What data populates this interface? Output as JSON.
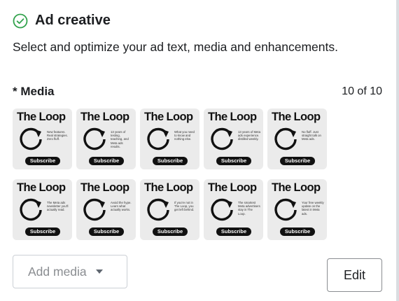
{
  "header": {
    "title": "Ad creative",
    "subtitle": "Select and optimize your ad text, media and enhancements."
  },
  "media": {
    "label": "* Media",
    "count": "10 of 10",
    "thumbnails": [
      {
        "title": "The Loop",
        "text": "New features. Real strategies. Zero fluff.",
        "button": "Subscribe"
      },
      {
        "title": "The Loop",
        "text": "13 years of testing, teaching, and Meta ads results.",
        "button": "Subscribe"
      },
      {
        "title": "The Loop",
        "text": "What you need to know and nothing else.",
        "button": "Subscribe"
      },
      {
        "title": "The Loop",
        "text": "13 years of Meta ads experience. distilled weekly.",
        "button": "Subscribe"
      },
      {
        "title": "The Loop",
        "text": "No fluff. Just straight talk on Meta ads.",
        "button": "Subscribe"
      },
      {
        "title": "The Loop",
        "text": "The Meta ads newsletter you'll actually read.",
        "button": "Subscribe"
      },
      {
        "title": "The Loop",
        "text": "Avoid the hype. Learn what actually works.",
        "button": "Subscribe"
      },
      {
        "title": "The Loop",
        "text": "If you're not in The Loop, you get left behind.",
        "button": "Subscribe"
      },
      {
        "title": "The Loop",
        "text": "The smartest Meta advertisers stay in The Loop.",
        "button": "Subscribe"
      },
      {
        "title": "The Loop",
        "text": "Your free weekly update on the latest in Meta ads.",
        "button": "Subscribe"
      }
    ]
  },
  "actions": {
    "add_media_label": "Add media",
    "edit_label": "Edit"
  },
  "icons": {
    "header": "check-circle-icon",
    "dropdown": "caret-down-icon",
    "thumbnail": "loop-arrow-icon"
  },
  "colors": {
    "accent_green": "#31a24c",
    "text": "#1c1e21",
    "muted": "#8a8d91"
  }
}
